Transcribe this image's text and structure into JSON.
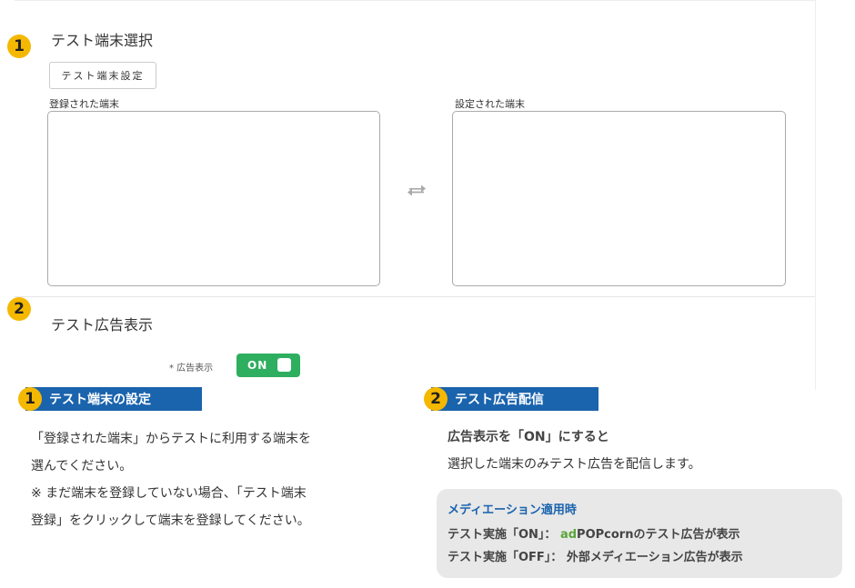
{
  "section1": {
    "number": "1",
    "title": "テスト端末選択",
    "settings_button": "テスト端末設定",
    "registered_label": "登録された端末",
    "configured_label": "設定された端末"
  },
  "section2": {
    "number": "2",
    "title": "テスト広告表示",
    "toggle_label": "* 広告表示",
    "toggle_value": "ON"
  },
  "explain1": {
    "number": "1",
    "title": "テスト端末の設定",
    "line1": "「登録された端末」からテストに利用する端末を",
    "line2": "選んでください。",
    "line3": "※ まだ端末を登録していない場合、「テスト端末",
    "line4": "登録」をクリックして端末を登録してください。"
  },
  "explain2": {
    "number": "2",
    "title": "テスト広告配信",
    "line1": "広告表示を「ON」にすると",
    "line2": "選択した端末のみテスト広告を配信します。",
    "mediation_title": "メディエーション適用時",
    "on_prefix": "テスト実施「ON」：",
    "on_ad": "ad",
    "on_suffix": "POPcornのテスト広告が表示",
    "off_line": "テスト実施「OFF」： 外部メディエーション広告が表示"
  },
  "colors": {
    "badge": "#f5b800",
    "banner": "#1a63ad",
    "toggle_on": "#2eae5f",
    "ad_green": "#5aa53b"
  }
}
